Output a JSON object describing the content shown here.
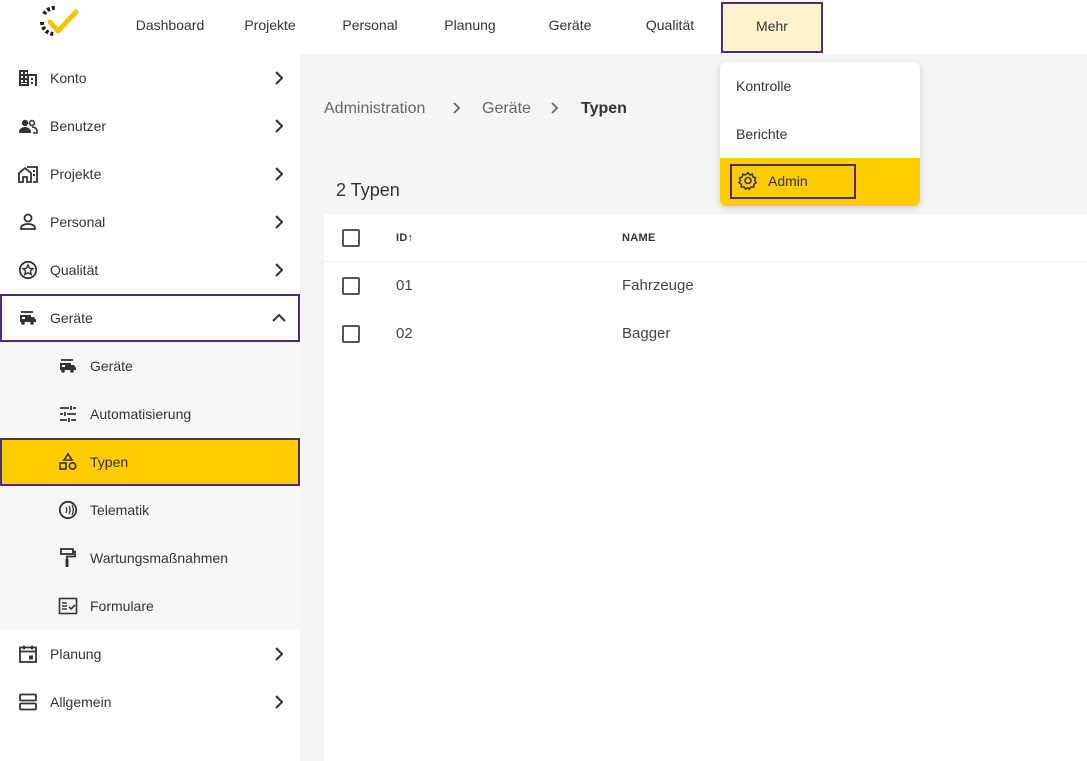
{
  "topnav": {
    "items": [
      {
        "label": "Dashboard"
      },
      {
        "label": "Projekte"
      },
      {
        "label": "Personal"
      },
      {
        "label": "Planung"
      },
      {
        "label": "Geräte"
      },
      {
        "label": "Qualität"
      },
      {
        "label": "Mehr"
      }
    ],
    "logo_icon": "brand-logo-icon",
    "accent_color": "#ffcc00",
    "highlight_outline_color": "#4b2d7f"
  },
  "sidebar": {
    "items": [
      {
        "label": "Konto",
        "icon": "building-icon"
      },
      {
        "label": "Benutzer",
        "icon": "users-icon"
      },
      {
        "label": "Projekte",
        "icon": "home-work-icon"
      },
      {
        "label": "Personal",
        "icon": "person-icon"
      },
      {
        "label": "Qualität",
        "icon": "star-badge-icon"
      },
      {
        "label": "Geräte",
        "icon": "rv-vehicle-icon"
      },
      {
        "label": "Planung",
        "icon": "calendar-icon"
      },
      {
        "label": "Allgemein",
        "icon": "storage-icon"
      }
    ],
    "sub_items": [
      {
        "label": "Geräte",
        "icon": "rv-vehicle-icon"
      },
      {
        "label": "Automatisierung",
        "icon": "tune-icon"
      },
      {
        "label": "Typen",
        "icon": "category-icon"
      },
      {
        "label": "Telematik",
        "icon": "contactless-icon"
      },
      {
        "label": "Wartungsmaßnahmen",
        "icon": "format-paint-icon"
      },
      {
        "label": "Formulare",
        "icon": "fact-check-icon"
      }
    ]
  },
  "breadcrumb": [
    "Administration",
    "Geräte",
    "Typen"
  ],
  "main": {
    "count_title": "2 Typen",
    "table": {
      "columns": [
        "ID",
        "NAME"
      ],
      "sort_indicator": "↑",
      "rows": [
        {
          "id": "01",
          "name": "Fahrzeuge"
        },
        {
          "id": "02",
          "name": "Bagger"
        }
      ]
    }
  },
  "dropdown": {
    "items": [
      {
        "label": "Kontrolle"
      },
      {
        "label": "Berichte"
      },
      {
        "label": "Admin",
        "icon": "gear-icon"
      }
    ]
  }
}
